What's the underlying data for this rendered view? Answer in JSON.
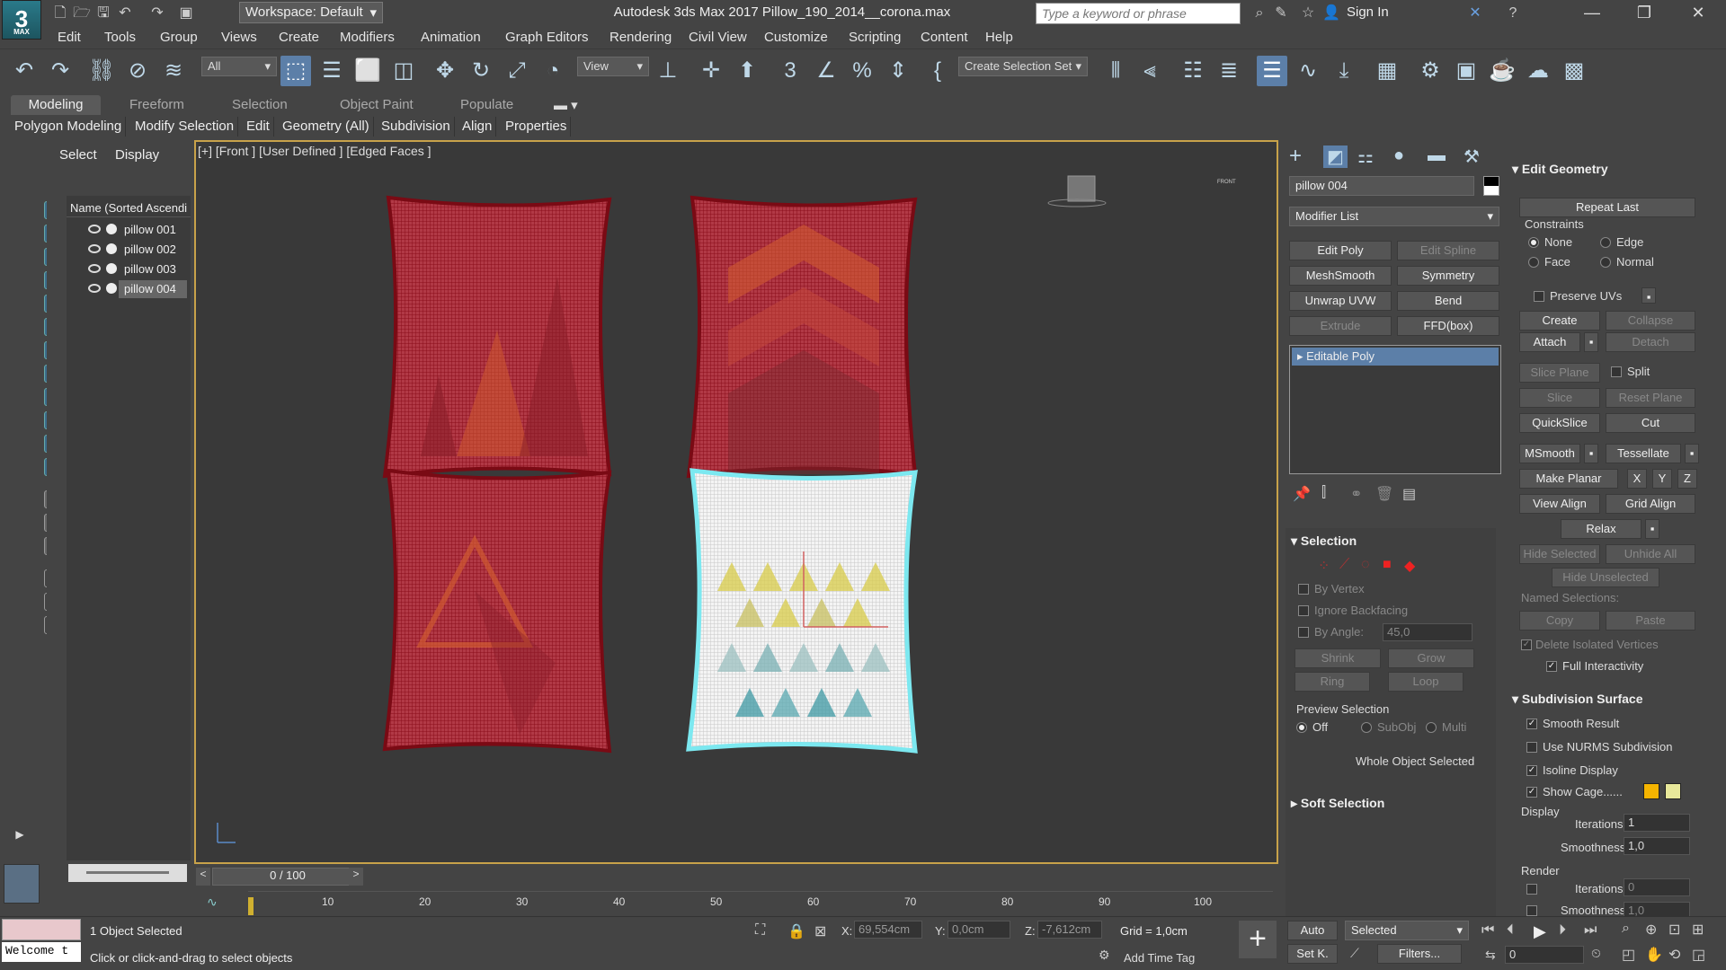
{
  "app": {
    "logo": "3",
    "logo_sub": "MAX",
    "workspace": "Workspace: Default",
    "title": "Autodesk 3ds Max 2017    Pillow_190_2014__corona.max",
    "search_placeholder": "Type a keyword or phrase",
    "sign_in": "Sign In"
  },
  "menu": [
    "Edit",
    "Tools",
    "Group",
    "Views",
    "Create",
    "Modifiers",
    "Animation",
    "Graph Editors",
    "Rendering",
    "Civil View",
    "Customize",
    "Scripting",
    "Content",
    "Help"
  ],
  "toolbar": {
    "filter": "All",
    "refcoord": "View",
    "selection_set": "Create Selection Set"
  },
  "ribbon": {
    "tabs": [
      "Modeling",
      "Freeform",
      "Selection",
      "Object Paint",
      "Populate"
    ],
    "subtabs": [
      "Polygon Modeling",
      "Modify Selection",
      "Edit",
      "Geometry (All)",
      "Subdivision",
      "Align",
      "Properties"
    ]
  },
  "explorer": {
    "tabs": [
      "Select",
      "Display"
    ],
    "header": "Name (Sorted Ascendi",
    "items": [
      "pillow 001",
      "pillow 002",
      "pillow 003",
      "pillow 004"
    ]
  },
  "viewport": {
    "label": "[+] [Front ] [User Defined ] [Edged Faces ]",
    "viewcube": "FRONT"
  },
  "modify": {
    "object_name": "pillow 004",
    "modifier_list": "Modifier List",
    "modifier_buttons": [
      "Edit Poly",
      "Edit Spline",
      "MeshSmooth",
      "Symmetry",
      "Unwrap UVW",
      "Bend",
      "Extrude",
      "FFD(box)"
    ],
    "stack_item": "Editable Poly"
  },
  "selection_rollout": {
    "title": "Selection",
    "by_vertex": "By Vertex",
    "ignore_backfacing": "Ignore Backfacing",
    "by_angle": "By Angle:",
    "angle_value": "45,0",
    "shrink": "Shrink",
    "grow": "Grow",
    "ring": "Ring",
    "loop": "Loop",
    "preview": "Preview Selection",
    "off": "Off",
    "subobj": "SubObj",
    "multi": "Multi",
    "status": "Whole Object Selected",
    "soft": "Soft Selection"
  },
  "edit_geometry": {
    "title": "Edit Geometry",
    "repeat_last": "Repeat Last",
    "constraints": "Constraints",
    "none": "None",
    "edge": "Edge",
    "face": "Face",
    "normal": "Normal",
    "preserve_uvs": "Preserve UVs",
    "create": "Create",
    "collapse": "Collapse",
    "attach": "Attach",
    "detach": "Detach",
    "slice_plane": "Slice Plane",
    "split": "Split",
    "slice": "Slice",
    "reset_plane": "Reset Plane",
    "quickslice": "QuickSlice",
    "cut": "Cut",
    "msmooth": "MSmooth",
    "tessellate": "Tessellate",
    "make_planar": "Make Planar",
    "x": "X",
    "y": "Y",
    "z": "Z",
    "view_align": "View Align",
    "grid_align": "Grid Align",
    "relax": "Relax",
    "hide_selected": "Hide Selected",
    "unhide_all": "Unhide All",
    "hide_unselected": "Hide Unselected",
    "named_selections": "Named Selections:",
    "copy": "Copy",
    "paste": "Paste",
    "delete_isolated": "Delete Isolated Vertices",
    "full_interactivity": "Full Interactivity"
  },
  "subdivision": {
    "title": "Subdivision Surface",
    "smooth_result": "Smooth Result",
    "use_nurms": "Use NURMS Subdivision",
    "isoline": "Isoline Display",
    "show_cage": "Show Cage......",
    "display": "Display",
    "iterations_label": "Iterations:",
    "iterations": "1",
    "smoothness_label": "Smoothness:",
    "smoothness": "1,0",
    "render": "Render",
    "render_iterations": "0",
    "render_smoothness": "1,0",
    "cage_color1": "#f5b400",
    "cage_color2": "#e8e89a"
  },
  "timeline": {
    "frame": "0 / 100",
    "ticks": [
      "10",
      "20",
      "30",
      "40",
      "50",
      "60",
      "70",
      "80",
      "90",
      "100"
    ]
  },
  "status": {
    "objects": "1 Object Selected",
    "prompt": "Click or click-and-drag to select objects",
    "maxscript": "Welcome t",
    "x_label": "X:",
    "x": "69,554cm",
    "y_label": "Y:",
    "y": "0,0cm",
    "z_label": "Z:",
    "z": "-7,612cm",
    "grid": "Grid = 1,0cm",
    "add_time_tag": "Add Time Tag",
    "auto": "Auto",
    "set_key": "Set K.",
    "selected": "Selected",
    "filters": "Filters...",
    "frame_value": "0"
  },
  "colors": {
    "wire_red": "#a0141e",
    "selection_cyan": "#7ce8f0",
    "viewport_border": "#c8a24a",
    "active_blue": "#5c7fa8"
  }
}
